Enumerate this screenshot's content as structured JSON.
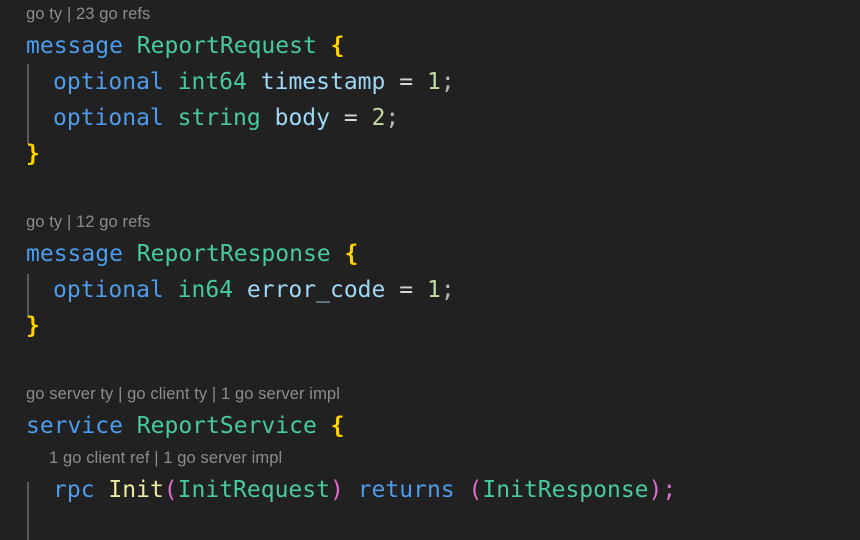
{
  "editor": {
    "language": "protobuf",
    "background_color": "#212121",
    "font_size_px": 23
  },
  "colors": {
    "background": "#212121",
    "codelens": "#8c8c8c",
    "keyword": "#4d9bea",
    "type": "#48c9a0",
    "field": "#9fd6f5",
    "brace": "#ffd400",
    "number": "#c3dba0",
    "operator": "#d6d6d6",
    "punctuation": "#b9b9b9",
    "paren": "#e06cd0",
    "identifier": "#ece8a3",
    "indent_guide": "#5a5a5a"
  },
  "blocks": [
    {
      "codelens": "go ty | 23 go refs",
      "declaration": {
        "keyword": "message",
        "name": "ReportRequest",
        "open_brace": "{"
      },
      "fields": [
        {
          "label": "optional",
          "type": "int64",
          "name": "timestamp",
          "equals": "=",
          "number": "1",
          "semicolon": ";"
        },
        {
          "label": "optional",
          "type": "string",
          "name": "body",
          "equals": "=",
          "number": "2",
          "semicolon": ";"
        }
      ],
      "close_brace": "}"
    },
    {
      "codelens": "go ty | 12 go refs",
      "declaration": {
        "keyword": "message",
        "name": "ReportResponse",
        "open_brace": "{"
      },
      "fields": [
        {
          "label": "optional",
          "type": "in64",
          "name": "error_code",
          "equals": "=",
          "number": "1",
          "semicolon": ";"
        }
      ],
      "close_brace": "}"
    },
    {
      "codelens": "go server ty | go client ty | 1 go server impl",
      "declaration": {
        "keyword": "service",
        "name": "ReportService",
        "open_brace": "{"
      },
      "method_codelens": "1 go client ref | 1 go server impl",
      "method": {
        "keyword": "rpc",
        "name": "Init",
        "open_paren": "(",
        "request": "InitRequest",
        "close_paren": ")",
        "returns": "returns",
        "returns_open_paren": "(",
        "response": "InitResponse",
        "returns_close_paren": ")",
        "semicolon": ";"
      }
    }
  ]
}
